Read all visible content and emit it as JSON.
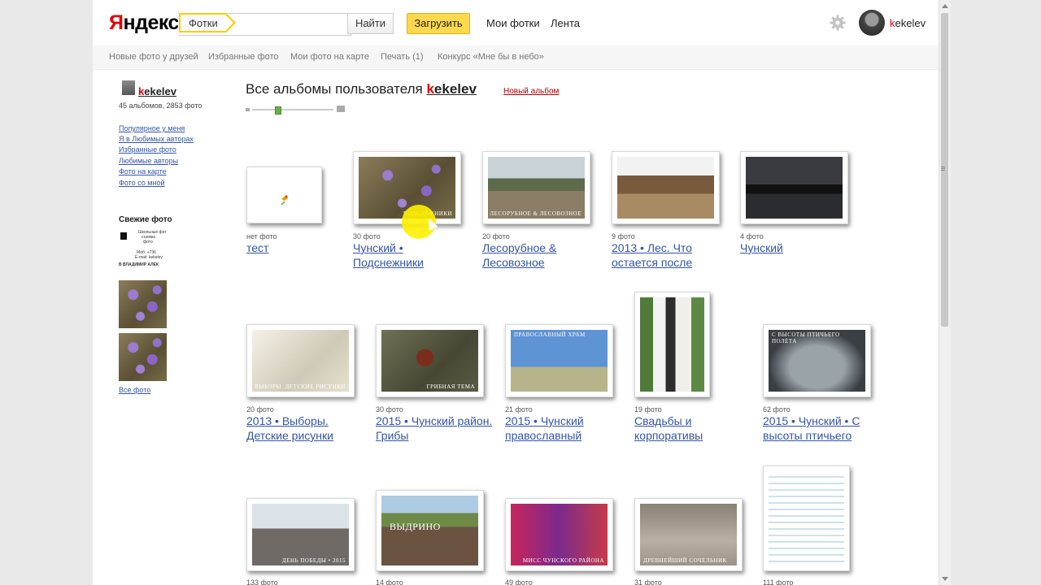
{
  "header": {
    "logo_ya": "Я",
    "logo_rest": "ндекс",
    "search_tag": "Фотки",
    "search_placeholder": "",
    "find_label": "Найти",
    "upload_label": "Загрузить",
    "nav": [
      "Мои фотки",
      "Лента"
    ],
    "user_k": "k",
    "user_rest": "ekelev"
  },
  "subnav": [
    "Новые фото у друзей",
    "Избранные фото",
    "Мои фото на карте",
    "Печать (1)",
    "Конкурс «Мне бы в небо»"
  ],
  "sidebar": {
    "user_k": "k",
    "user_rest": "ekelev",
    "stats": "45 альбомов, 2853 фото",
    "links": [
      "Популярное у меня",
      "Я в Любимых авторах",
      "Избранные фото",
      "Любимые авторы",
      "Фото на карте",
      "Фото со мной"
    ],
    "fresh_title": "Свежие фото",
    "doc_lines": [
      "Школьные фот",
      "съемка",
      "фото",
      "Моб: +736",
      "E-mail: kekelev",
      "В ВЛАДИМИР АЛЕК"
    ],
    "all_photos": "Все фото"
  },
  "main": {
    "title_prefix": "Все альбомы пользователя ",
    "owner_k": "k",
    "owner_rest": "ekelev",
    "new_album": "Новый альбом",
    "albums": [
      {
        "count": "нет фото",
        "name": "тест",
        "caption": ""
      },
      {
        "count": "30 фото",
        "name": "Чунский • Подснежники",
        "caption": "ПОДСНЕЖНИКИ"
      },
      {
        "count": "20 фото",
        "name": "Лесорубное & Лесовозное",
        "caption": "ЛЕСОРУБНОЕ & ЛЕСОВОЗНОЕ"
      },
      {
        "count": "9 фото",
        "name": "2013 • Лес. Что остается после",
        "caption": ""
      },
      {
        "count": "4 фото",
        "name": "Чунский",
        "caption": ""
      },
      {
        "count": "20 фото",
        "name": "2013 • Выборы. Детские рисунки",
        "caption": "ВЫБОРЫ. ДЕТСКИЕ РИСУНКИ"
      },
      {
        "count": "30 фото",
        "name": "2015 • Чунский район. Грибы",
        "caption": "ГРИБНАЯ ТЕМА"
      },
      {
        "count": "21 фото",
        "name": "2015 • Чунский православный",
        "caption": "ПРАВОСЛАВНЫЙ ХРАМ"
      },
      {
        "count": "19 фото",
        "name": "Свадьбы и корпоративы",
        "caption": ""
      },
      {
        "count": "62 фото",
        "name": "2015 • Чунский • С высоты птичьего",
        "caption": "С ВЫСОТЫ ПТИЧЬЕГО ПОЛЁТА"
      },
      {
        "count": "133 фото",
        "name": "",
        "caption": "ДЕНЬ ПОБЕДЫ • 2015"
      },
      {
        "count": "14 фото",
        "name": "",
        "caption": "ВЫДРИНО"
      },
      {
        "count": "49 фото",
        "name": "",
        "caption": "МИСС ЧУНСКОГО РАЙОНА"
      },
      {
        "count": "31 фото",
        "name": "",
        "caption": "ДРЕВНЕЙШИЙ СОЧЕЛЬНИК"
      },
      {
        "count": "111 фото",
        "name": "",
        "caption": ""
      }
    ]
  },
  "colors": {
    "accent_red": "#e30000",
    "upload_yellow": "#ffd84d",
    "link_blue": "#3355aa"
  }
}
